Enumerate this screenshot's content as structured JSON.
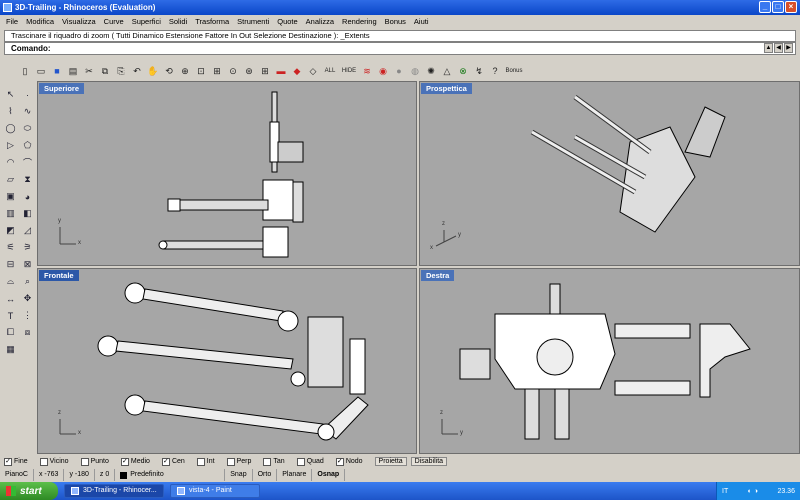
{
  "window": {
    "title": "3D-Trailing - Rhinoceros (Evaluation)"
  },
  "menu": [
    "File",
    "Modifica",
    "Visualizza",
    "Curve",
    "Superfici",
    "Solidi",
    "Trasforma",
    "Strumenti",
    "Quote",
    "Analizza",
    "Rendering",
    "Bonus",
    "Aiuti"
  ],
  "command": {
    "history": "Trascinare il riquadro di zoom ( Tutti  Dinamico  Estensione  Fattore  In  Out  Selezione  Destinazione ): _Extents",
    "prompt": "Comando:"
  },
  "toolbar": {
    "all_label": "ALL",
    "hide_label": "HIDE",
    "bonus_label": "Bonus",
    "help_label": "?"
  },
  "viewports": {
    "top": {
      "title": "Superiore"
    },
    "perspective": {
      "title": "Prospettica"
    },
    "front": {
      "title": "Frontale"
    },
    "right": {
      "title": "Destra"
    }
  },
  "axes": {
    "x": "x",
    "y": "y",
    "z": "z"
  },
  "osnap": [
    {
      "label": "Fine",
      "checked": true
    },
    {
      "label": "Vicino",
      "checked": false
    },
    {
      "label": "Punto",
      "checked": false
    },
    {
      "label": "Medio",
      "checked": true
    },
    {
      "label": "Cen",
      "checked": true
    },
    {
      "label": "Int",
      "checked": false
    },
    {
      "label": "Perp",
      "checked": false
    },
    {
      "label": "Tan",
      "checked": false
    },
    {
      "label": "Quad",
      "checked": false
    },
    {
      "label": "Nodo",
      "checked": true
    }
  ],
  "osnap_buttons": {
    "project": "Proietta",
    "disable": "Disabilita"
  },
  "status": {
    "cplane": "PianoC",
    "x": "x -763",
    "y": "y -180",
    "z": "z 0",
    "layer": "Predefinito",
    "snap": "Snap",
    "ortho": "Orto",
    "planar": "Planare",
    "osnap": "Osnap"
  },
  "taskbar": {
    "start": "start",
    "tasks": [
      {
        "label": "3D-Trailing - Rhinocer...",
        "active": true
      },
      {
        "label": "vista-4 - Paint",
        "active": false
      }
    ],
    "lang": "IT",
    "clock": "23.36"
  }
}
